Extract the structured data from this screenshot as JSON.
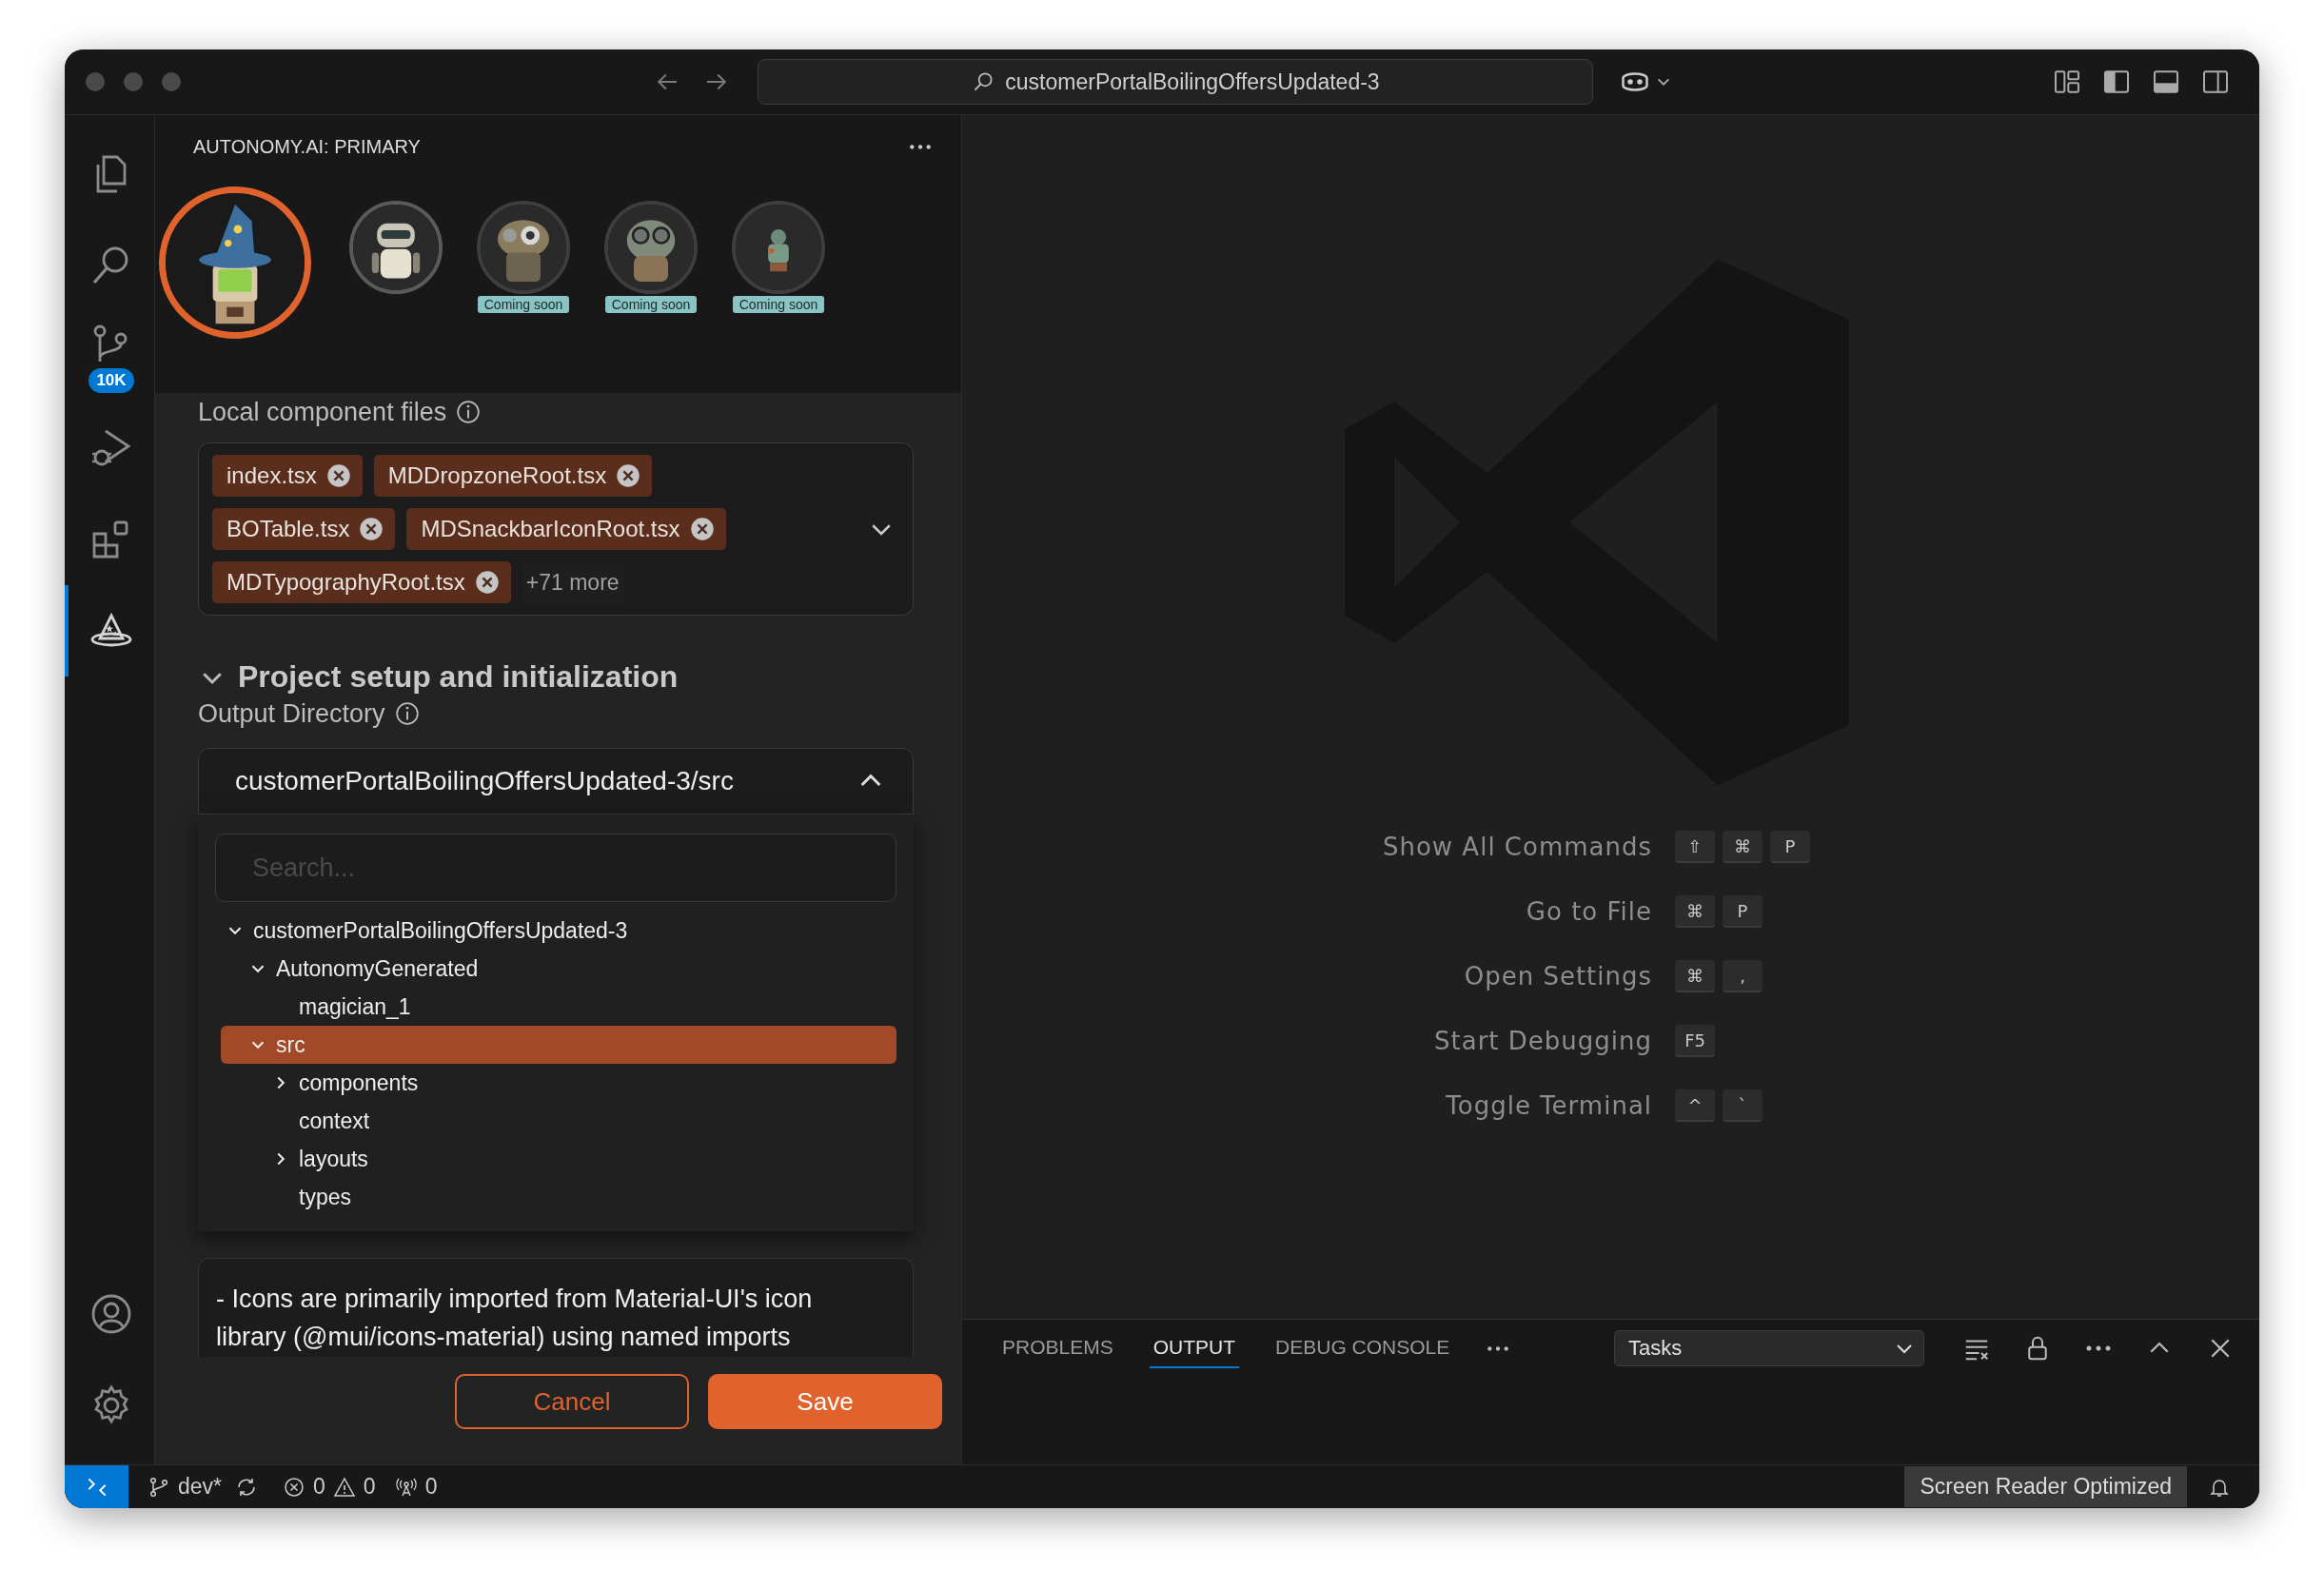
{
  "window": {
    "search": "customerPortalBoilingOffersUpdated-3"
  },
  "activity_bar": {
    "items": [
      {
        "kind": "files",
        "selected": false
      },
      {
        "kind": "search",
        "selected": false
      },
      {
        "kind": "source-control",
        "selected": false,
        "badge": "10K"
      },
      {
        "kind": "run-debug",
        "selected": false
      },
      {
        "kind": "extensions",
        "selected": false
      },
      {
        "kind": "wizard",
        "selected": true
      }
    ],
    "bottom_items": [
      {
        "kind": "account",
        "selected": false
      },
      {
        "kind": "settings",
        "selected": false
      }
    ]
  },
  "side_panel": {
    "title": "AUTONOMY.AI: PRIMARY",
    "agents": [
      {
        "kind": "picture",
        "selected": true
      },
      {
        "kind": "picture",
        "selected": false
      },
      {
        "kind": "picture",
        "selected": false,
        "badge": "Coming soon"
      },
      {
        "kind": "picture",
        "selected": false,
        "badge": "Coming soon"
      },
      {
        "kind": "picture",
        "selected": false,
        "badge": "Coming soon"
      }
    ],
    "local_files": {
      "label": "Local component files",
      "chips": [
        "index.tsx",
        "MDDropzoneRoot.tsx",
        "BOTable.tsx",
        "MDSnackbarIconRoot.tsx",
        "MDTypographyRoot.tsx"
      ],
      "more": "+71 more"
    },
    "section": {
      "title": "Project setup and initialization",
      "expanded": true
    },
    "output_directory": {
      "label": "Output Directory",
      "value": "customerPortalBoilingOffersUpdated-3/src",
      "expanded": true,
      "search_placeholder": "Search...",
      "tree": [
        {
          "label": "customerPortalBoilingOffersUpdated-3",
          "expanded": true,
          "selected": false,
          "children": [
            {
              "label": "AutonomyGenerated",
              "expanded": true,
              "selected": false,
              "children": [
                {
                  "label": "magician_1",
                  "selected": false
                }
              ]
            },
            {
              "label": "src",
              "expanded": true,
              "selected": true,
              "children": [
                {
                  "label": "components",
                  "expanded": false,
                  "selected": false
                },
                {
                  "label": "context",
                  "selected": false
                },
                {
                  "label": "layouts",
                  "expanded": false,
                  "selected": false
                },
                {
                  "label": "types",
                  "selected": false
                }
              ]
            }
          ]
        }
      ]
    },
    "notes": "- Icons are primarily imported from Material-UI's icon library (@mui/icons-material) using named imports",
    "buttons": {
      "cancel": "Cancel",
      "save": "Save"
    }
  },
  "editor": {
    "shortcuts": [
      {
        "label": "Show All Commands",
        "keys": [
          "⇧",
          "⌘",
          "P"
        ]
      },
      {
        "label": "Go to File",
        "keys": [
          "⌘",
          "P"
        ]
      },
      {
        "label": "Open Settings",
        "keys": [
          "⌘",
          ","
        ]
      },
      {
        "label": "Start Debugging",
        "keys": [
          "F5"
        ]
      },
      {
        "label": "Toggle Terminal",
        "keys": [
          "^",
          "`"
        ]
      }
    ]
  },
  "bottom_panel": {
    "tabs": [
      {
        "label": "PROBLEMS",
        "selected": false
      },
      {
        "label": "OUTPUT",
        "selected": true
      },
      {
        "label": "DEBUG CONSOLE",
        "selected": false
      }
    ],
    "dropdown": "Tasks"
  },
  "status_bar": {
    "branch": "dev*",
    "errors": "0",
    "warnings": "0",
    "ports": "0",
    "screen_reader": "Screen Reader Optimized"
  }
}
